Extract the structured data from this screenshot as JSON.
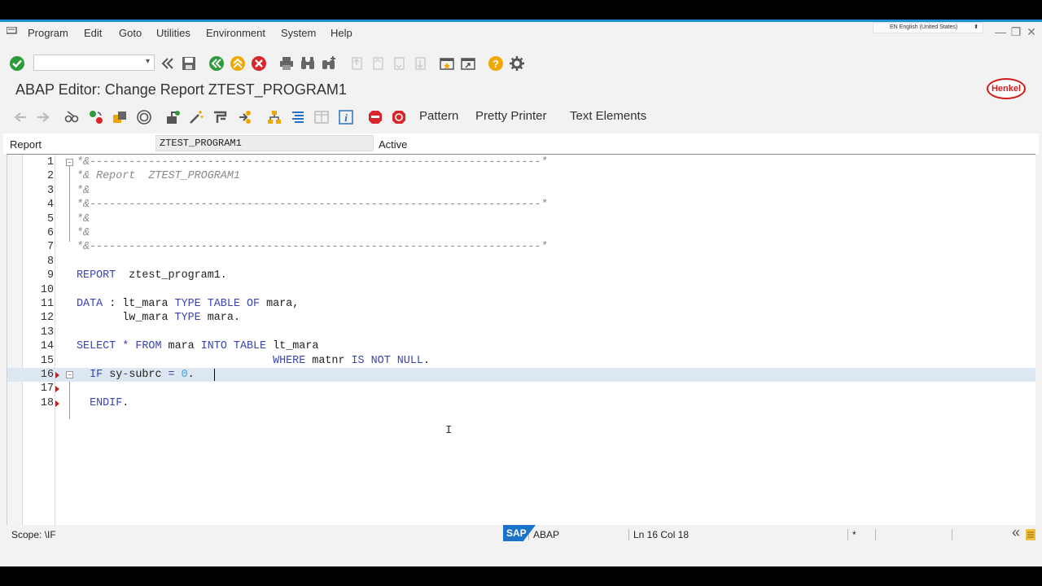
{
  "menu": {
    "items": [
      "Program",
      "Edit",
      "Goto",
      "Utilities",
      "Environment",
      "System",
      "Help"
    ],
    "language": "EN English (United States)"
  },
  "window_controls": {
    "minimize": "—",
    "restore": "❐",
    "close": "✕"
  },
  "command_field": {
    "value": ""
  },
  "title": "ABAP Editor: Change Report ZTEST_PROGRAM1",
  "logo_text": "Henkel",
  "app_toolbar": {
    "pattern": "Pattern",
    "pretty_printer": "Pretty Printer",
    "text_elements": "Text Elements"
  },
  "report_header": {
    "label": "Report",
    "name": "ZTEST_PROGRAM1",
    "status": "Active"
  },
  "editor": {
    "lines": [
      {
        "n": "1",
        "tokens": [
          [
            "c-com",
            "*&---------------------------------------------------------------------*"
          ]
        ],
        "fold": "minus"
      },
      {
        "n": "2",
        "tokens": [
          [
            "c-com",
            "*& Report  ZTEST_PROGRAM1"
          ]
        ]
      },
      {
        "n": "3",
        "tokens": [
          [
            "c-com",
            "*&"
          ]
        ]
      },
      {
        "n": "4",
        "tokens": [
          [
            "c-com",
            "*&---------------------------------------------------------------------*"
          ]
        ]
      },
      {
        "n": "5",
        "tokens": [
          [
            "c-com",
            "*&"
          ]
        ]
      },
      {
        "n": "6",
        "tokens": [
          [
            "c-com",
            "*&"
          ]
        ]
      },
      {
        "n": "7",
        "tokens": [
          [
            "c-com",
            "*&---------------------------------------------------------------------*"
          ]
        ]
      },
      {
        "n": "8",
        "tokens": []
      },
      {
        "n": "9",
        "tokens": [
          [
            "c-kw",
            "REPORT"
          ],
          [
            "c-txt",
            "  ztest_program1."
          ]
        ]
      },
      {
        "n": "10",
        "tokens": []
      },
      {
        "n": "11",
        "tokens": [
          [
            "c-kw",
            "DATA"
          ],
          [
            "c-txt",
            " : lt_mara "
          ],
          [
            "c-kw",
            "TYPE TABLE OF"
          ],
          [
            "c-txt",
            " mara,"
          ]
        ]
      },
      {
        "n": "12",
        "tokens": [
          [
            "c-txt",
            "       lw_mara "
          ],
          [
            "c-kw",
            "TYPE"
          ],
          [
            "c-txt",
            " mara."
          ]
        ]
      },
      {
        "n": "13",
        "tokens": []
      },
      {
        "n": "14",
        "tokens": [
          [
            "c-kw",
            "SELECT"
          ],
          [
            "c-txt",
            " "
          ],
          [
            "c-op",
            "*"
          ],
          [
            "c-txt",
            " "
          ],
          [
            "c-kw",
            "FROM"
          ],
          [
            "c-txt",
            " mara "
          ],
          [
            "c-kw",
            "INTO TABLE"
          ],
          [
            "c-txt",
            " lt_mara"
          ]
        ]
      },
      {
        "n": "15",
        "tokens": [
          [
            "c-txt",
            "                              "
          ],
          [
            "c-kw",
            "WHERE"
          ],
          [
            "c-txt",
            " matnr "
          ],
          [
            "c-kw",
            "IS NOT NULL"
          ],
          [
            "c-txt",
            "."
          ]
        ]
      },
      {
        "n": "16",
        "tokens": [
          [
            "c-txt",
            "  "
          ],
          [
            "c-kw",
            "IF"
          ],
          [
            "c-txt",
            " sy"
          ],
          [
            "c-op",
            "-"
          ],
          [
            "c-txt",
            "subrc "
          ],
          [
            "c-op",
            "="
          ],
          [
            "c-txt",
            " "
          ],
          [
            "c-num",
            "0"
          ],
          [
            "c-txt",
            "."
          ]
        ],
        "fold": "minus",
        "bp": true,
        "current": true
      },
      {
        "n": "17",
        "tokens": [],
        "bp": true
      },
      {
        "n": "18",
        "tokens": [
          [
            "c-txt",
            "  "
          ],
          [
            "c-kw",
            "ENDIF"
          ],
          [
            "c-txt",
            "."
          ]
        ],
        "bp": true
      }
    ]
  },
  "status_bar": {
    "scope": "Scope: \\IF",
    "language": "ABAP",
    "position": "Ln  16 Col   18",
    "modified": "*"
  },
  "sap_logo": "SAP"
}
